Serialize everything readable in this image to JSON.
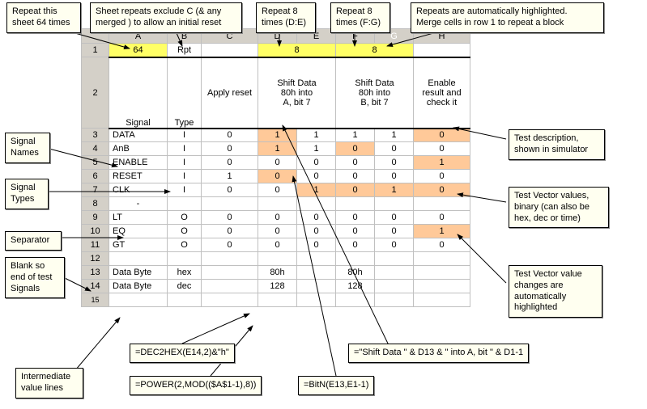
{
  "callouts": {
    "c1": "Repeat this\nsheet 64 times",
    "c2": "Sheet repeats exclude C (& any\nmerged ) to allow an initial reset",
    "c3": "Repeat 8\ntimes (D:E)",
    "c4": "Repeat 8\ntimes (F:G)",
    "c5": "Repeats are automatically highlighted.\nMerge cells in row 1 to repeat a block",
    "c6": "Signal\nNames",
    "c7": "Signal\nTypes",
    "c8": "Separator",
    "c9": "Blank so\nend of test\nSignals",
    "c10": "Intermediate\nvalue lines",
    "c11": "Test description,\nshown in simulator",
    "c12": "Test Vector values,\nbinary (can also be\nhex, dec or time)",
    "c13": "Test Vector value\nchanges are\nautomatically\nhighlighted"
  },
  "colHdr": {
    "A": "A",
    "B": "B",
    "C": "C",
    "D": "D",
    "E": "E",
    "F": "F",
    "G": "G",
    "H": "H"
  },
  "rowHdr": [
    "1",
    "2",
    "3",
    "4",
    "5",
    "6",
    "7",
    "8",
    "9",
    "10",
    "11",
    "12",
    "13",
    "14",
    "15"
  ],
  "r1": {
    "A": "64",
    "B": "Rpt",
    "DE": "8",
    "FG": "8"
  },
  "r2": {
    "A": "Signal",
    "B": "Type",
    "C": "Apply reset",
    "DE": "Shift Data\n80h into\nA, bit 7",
    "FG": "Shift Data\n80h into\nB, bit 7",
    "H": "Enable\nresult and\ncheck it"
  },
  "r3": {
    "A": "DATA",
    "B": "I",
    "C": "0",
    "D": "1",
    "E": "1",
    "F": "1",
    "G": "1",
    "H": "0"
  },
  "r4": {
    "A": "AnB",
    "B": "I",
    "C": "0",
    "D": "1",
    "E": "1",
    "F": "0",
    "G": "0",
    "H": "0"
  },
  "r5": {
    "A": "ENABLE",
    "B": "I",
    "C": "0",
    "D": "0",
    "E": "0",
    "F": "0",
    "G": "0",
    "H": "1"
  },
  "r6": {
    "A": "RESET",
    "B": "I",
    "C": "1",
    "D": "0",
    "E": "0",
    "F": "0",
    "G": "0",
    "H": "0"
  },
  "r7": {
    "A": "CLK",
    "B": "I",
    "C": "0",
    "D": "0",
    "E": "1",
    "F": "0",
    "G": "1",
    "H": "0"
  },
  "r8": {
    "A": "-"
  },
  "r9": {
    "A": "LT",
    "B": "O",
    "C": "0",
    "D": "0",
    "E": "0",
    "F": "0",
    "G": "0",
    "H": "0"
  },
  "r10": {
    "A": "EQ",
    "B": "O",
    "C": "0",
    "D": "0",
    "E": "0",
    "F": "0",
    "G": "0",
    "H": "1"
  },
  "r11": {
    "A": "GT",
    "B": "O",
    "C": "0",
    "D": "0",
    "E": "0",
    "F": "0",
    "G": "0",
    "H": "0"
  },
  "r13": {
    "A": "Data Byte",
    "B": "hex",
    "D": "80h",
    "F": "80h"
  },
  "r14": {
    "A": "Data Byte",
    "B": "dec",
    "D": "128",
    "F": "128"
  },
  "formulas": {
    "f1": "=DEC2HEX(E14,2)&\"h\"",
    "f2": "=POWER(2,MOD(($A$1-1),8))",
    "f3": "=BitN(E13,E1-1)",
    "f4": "=\"Shift Data \" & D13 & \" into A, bit \" & D1-1"
  }
}
